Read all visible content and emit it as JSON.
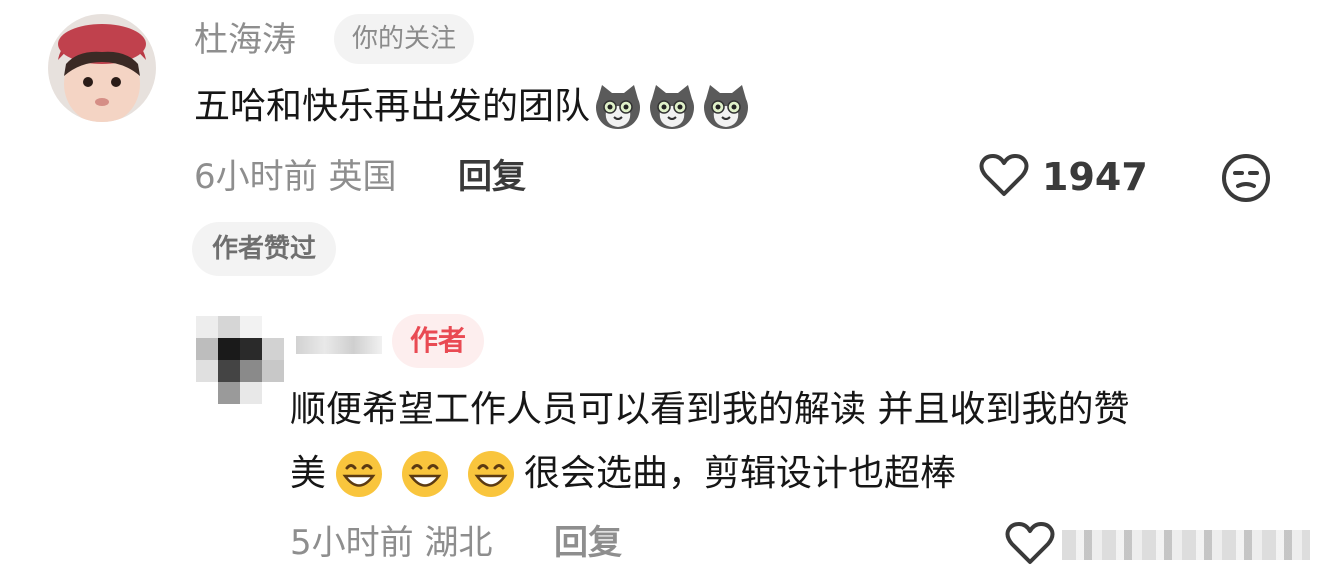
{
  "top_comment": {
    "username": "杜海涛",
    "follow_badge": "你的关注",
    "text": "五哈和快乐再出发的团队",
    "emoji_icons": [
      "cat-face-icon",
      "cat-face-icon",
      "cat-face-icon"
    ],
    "time": "6小时前",
    "location": "英国",
    "reply_label": "回复",
    "like_icon": "heart-outline-icon",
    "like_count": "1947",
    "dislike_icon": "unamused-face-icon",
    "author_liked_badge": "作者赞过"
  },
  "reply": {
    "author_badge": "作者",
    "text_line1": "顺便希望工作人员可以看到我的解读 并且收到我的赞",
    "text_line2_prefix": "美",
    "emoji_icons": [
      "grinning-face-icon",
      "grinning-face-icon",
      "grinning-face-icon"
    ],
    "text_line2_suffix": "很会选曲，剪辑设计也超棒",
    "time": "5小时前",
    "location": "湖北",
    "reply_label": "回复",
    "like_icon": "heart-outline-icon"
  },
  "colors": {
    "text_primary": "#161616",
    "text_secondary": "#8e8e8e",
    "badge_bg": "#f3f3f3",
    "author_badge_bg": "#fdeeee",
    "author_badge_text": "#e94a53"
  }
}
